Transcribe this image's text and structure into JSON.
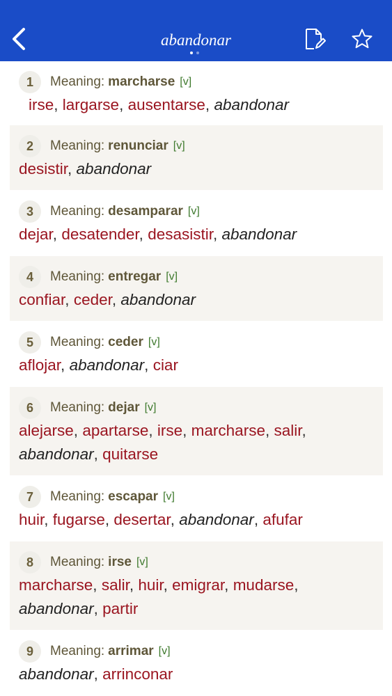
{
  "header": {
    "title": "abandonar",
    "page_count": 2,
    "active_page": 0
  },
  "meaning_label": "Meaning:",
  "entries": [
    {
      "num": "1",
      "meaning": "marcharse",
      "pos": "[v]",
      "lines": [
        [
          {
            "w": "irse"
          },
          {
            "w": "largarse"
          },
          {
            "w": "ausentarse"
          },
          {
            "w": "abandonar",
            "head": true
          }
        ]
      ]
    },
    {
      "num": "2",
      "meaning": "renunciar",
      "pos": "[v]",
      "lines": [
        [
          {
            "w": "desistir"
          },
          {
            "w": "abandonar",
            "head": true
          }
        ]
      ]
    },
    {
      "num": "3",
      "meaning": "desamparar",
      "pos": "[v]",
      "lines": [
        [
          {
            "w": "dejar"
          },
          {
            "w": "desatender"
          },
          {
            "w": "desasistir"
          },
          {
            "w": "abandonar",
            "head": true
          }
        ]
      ]
    },
    {
      "num": "4",
      "meaning": "entregar",
      "pos": "[v]",
      "lines": [
        [
          {
            "w": "confiar"
          },
          {
            "w": "ceder"
          },
          {
            "w": "abandonar",
            "head": true
          }
        ]
      ]
    },
    {
      "num": "5",
      "meaning": "ceder",
      "pos": "[v]",
      "lines": [
        [
          {
            "w": "aflojar"
          },
          {
            "w": "abandonar",
            "head": true
          },
          {
            "w": "ciar"
          }
        ]
      ]
    },
    {
      "num": "6",
      "meaning": "dejar",
      "pos": "[v]",
      "lines": [
        [
          {
            "w": "alejarse"
          },
          {
            "w": "apartarse"
          },
          {
            "w": "irse"
          },
          {
            "w": "marcharse"
          },
          {
            "w": "salir",
            "trail": true
          }
        ],
        [
          {
            "w": "abandonar",
            "head": true
          },
          {
            "w": "quitarse"
          }
        ]
      ]
    },
    {
      "num": "7",
      "meaning": "escapar",
      "pos": "[v]",
      "lines": [
        [
          {
            "w": "huir"
          },
          {
            "w": "fugarse"
          },
          {
            "w": "desertar"
          },
          {
            "w": "abandonar",
            "head": true
          },
          {
            "w": "afufar"
          }
        ]
      ]
    },
    {
      "num": "8",
      "meaning": "irse",
      "pos": "[v]",
      "lines": [
        [
          {
            "w": "marcharse"
          },
          {
            "w": "salir"
          },
          {
            "w": "huir"
          },
          {
            "w": "emigrar"
          },
          {
            "w": "mudarse",
            "trail": true
          }
        ],
        [
          {
            "w": "abandonar",
            "head": true
          },
          {
            "w": "partir"
          }
        ]
      ]
    },
    {
      "num": "9",
      "meaning": "arrimar",
      "pos": "[v]",
      "lines": [
        [
          {
            "w": "abandonar",
            "head": true
          },
          {
            "w": "arrinconar"
          }
        ]
      ]
    }
  ]
}
